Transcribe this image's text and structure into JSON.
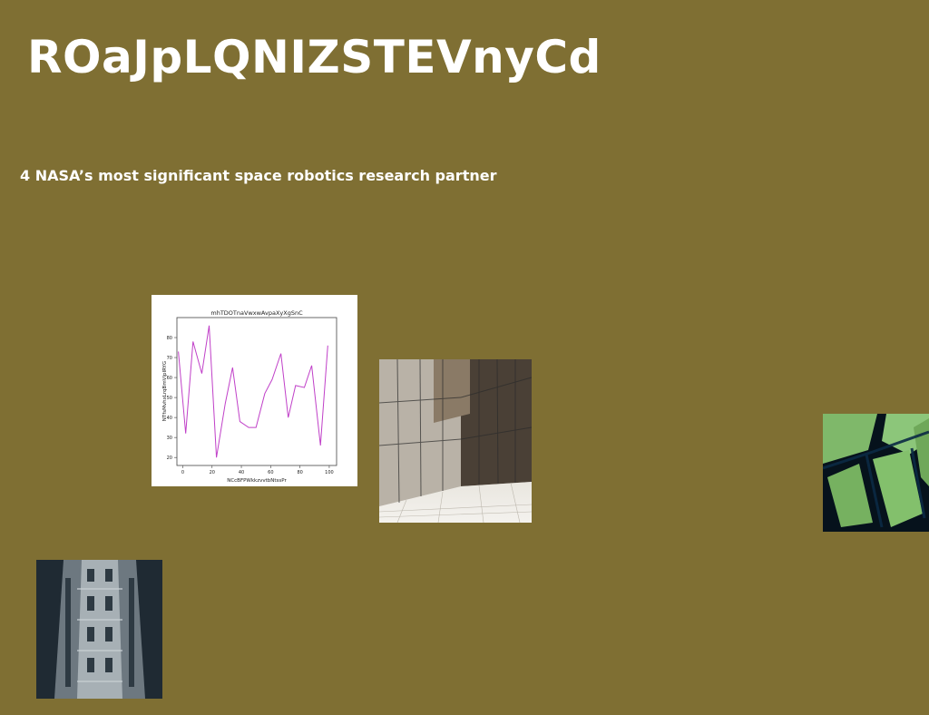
{
  "page": {
    "title": "ROaJpLQNIZSTEVnyCd",
    "subtitle": "4 NASA’s most significant space robotics research partner",
    "background_color": "#7f6f33"
  },
  "images": {
    "chart_card": "chart-image",
    "glass_photo": "glass-building-photo",
    "wing_photo": "butterfly-wing-photo",
    "tower_photo": "building-facade-photo"
  },
  "chart_data": {
    "type": "line",
    "title": "mhTDOTnaVwxwAvpaXyXgSnC",
    "xlabel": "NCcBFPWkkzvvtbNtssPr",
    "ylabel": "NTfsMvhxLrqBmVlpIRYG",
    "xlim": [
      -4,
      105
    ],
    "ylim": [
      16,
      90
    ],
    "xticks": [
      0,
      20,
      40,
      60,
      80,
      100
    ],
    "yticks": [
      20,
      30,
      40,
      50,
      60,
      70,
      80
    ],
    "grid": false,
    "series": [
      {
        "color": "#c040c8",
        "x": [
          -3,
          2,
          7,
          13,
          18,
          23,
          29,
          34,
          39,
          45,
          50,
          56,
          61,
          67,
          72,
          77,
          83,
          88,
          94,
          99
        ],
        "y": [
          73,
          32,
          78,
          62,
          86,
          20,
          47,
          65,
          38,
          35,
          35,
          52,
          59,
          72,
          40,
          56,
          55,
          66,
          26,
          76
        ]
      }
    ]
  }
}
